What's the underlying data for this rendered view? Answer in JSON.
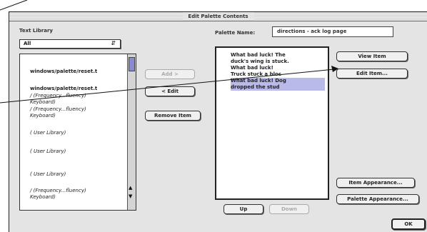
{
  "window": {
    "title": "Edit Palette Contents"
  },
  "library": {
    "label": "Text Library",
    "popup_value": "All",
    "items": [
      "windows/palette/reset.t",
      "windows/palette/reset.t",
      "/ (Frequency...fluency)",
      "Keyboard)",
      "/ (Frequency...fluency)",
      "Keyboard)",
      "( User Library)",
      "( User Library)",
      "( User Library)",
      "/ (Frequency...fluency)",
      "Keyboard)"
    ]
  },
  "palette_name": {
    "label": "Palette Name:",
    "value": "directions - ack log page"
  },
  "palette_items": [
    "What bad luck! The",
    "duck's wing is stuck.",
    "What bad luck!",
    "Truck stuck a bloc",
    "What bad luck! Dog",
    "dropped the stud"
  ],
  "buttons": {
    "add": "Add >",
    "edit": "< Edit",
    "remove": "Remove Item",
    "view_item": "View Item",
    "edit_item": "Edit Item...",
    "item_appearance": "Item Appearance...",
    "palette_appearance": "Palette Appearance...",
    "up": "Up",
    "down": "Down",
    "ok": "OK"
  }
}
